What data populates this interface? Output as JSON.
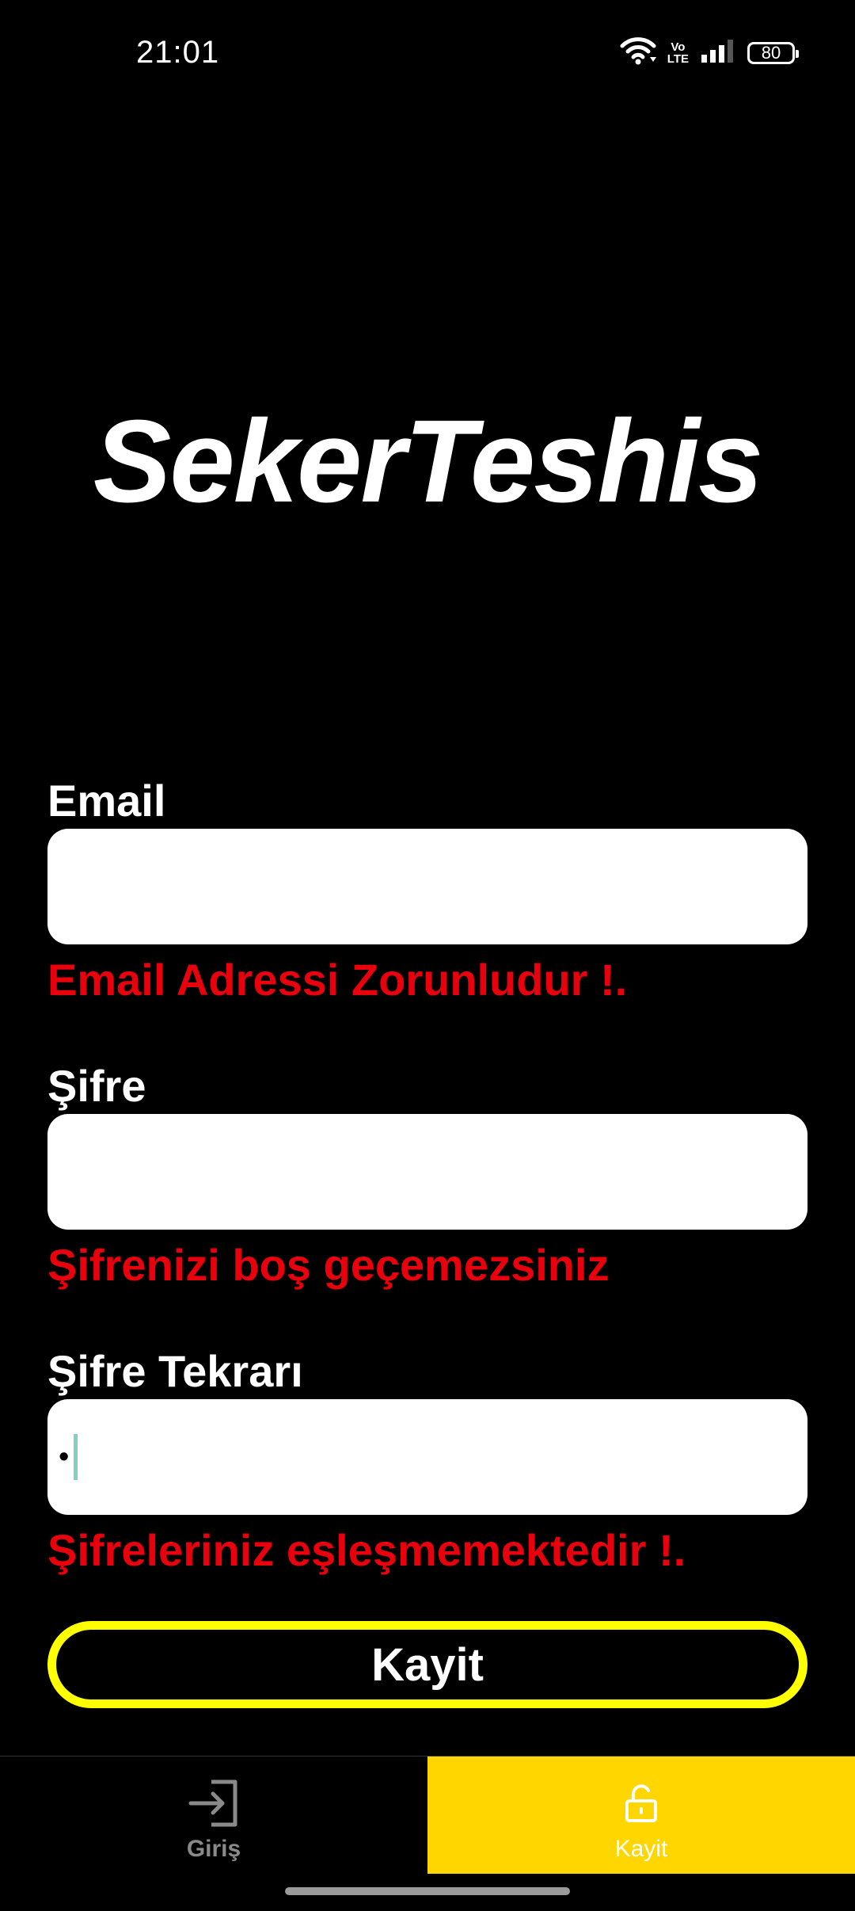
{
  "status_bar": {
    "time": "21:01",
    "network_label_top": "Vo",
    "network_label_bottom": "LTE",
    "battery_level": "80"
  },
  "app": {
    "title": "SekerTeshis"
  },
  "form": {
    "email": {
      "label": "Email",
      "value": "",
      "error": "Email Adressi Zorunludur !."
    },
    "password": {
      "label": "Şifre",
      "value": "",
      "error": "Şifrenizi boş geçemezsiniz"
    },
    "password_repeat": {
      "label": "Şifre Tekrarı",
      "value": "•",
      "error": "Şifreleriniz eşleşmemektedir !."
    },
    "submit_label": "Kayit"
  },
  "bottom_nav": {
    "items": [
      {
        "label": "Giriş",
        "icon": "login-arrow-icon",
        "active": false
      },
      {
        "label": "Kayit",
        "icon": "unlock-icon",
        "active": true
      }
    ]
  },
  "colors": {
    "background": "#000000",
    "error": "#e8000d",
    "button_border": "#ffff00",
    "nav_active": "#ffd600",
    "caret": "#7fd1c0"
  }
}
